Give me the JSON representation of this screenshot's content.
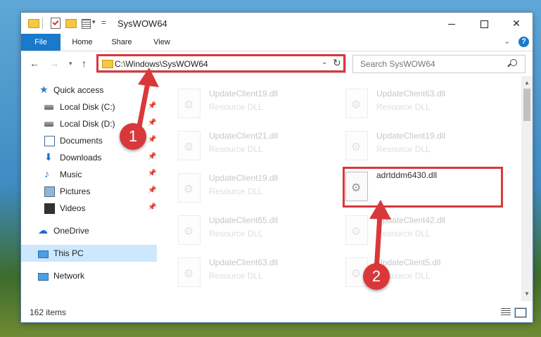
{
  "window": {
    "title": "SysWOW64",
    "minimize": "—",
    "maximize": "☐",
    "close": "✕"
  },
  "ribbon": {
    "tabs": [
      {
        "label": "File"
      },
      {
        "label": "Home"
      },
      {
        "label": "Share"
      },
      {
        "label": "View"
      }
    ],
    "help": "?"
  },
  "address": {
    "path": "C:\\Windows\\SysWOW64",
    "search_placeholder": "Search SysWOW64"
  },
  "sidebar": {
    "items": [
      {
        "label": "Quick access",
        "icon": "star-icon"
      },
      {
        "label": "Local Disk (C:)",
        "icon": "disk-icon"
      },
      {
        "label": "Local Disk (D:)",
        "icon": "disk-icon"
      },
      {
        "label": "Documents",
        "icon": "documents-icon"
      },
      {
        "label": "Downloads",
        "icon": "downloads-icon"
      },
      {
        "label": "Music",
        "icon": "music-icon"
      },
      {
        "label": "Pictures",
        "icon": "pictures-icon"
      },
      {
        "label": "Videos",
        "icon": "videos-icon"
      },
      {
        "label": "OneDrive",
        "icon": "onedrive-icon"
      },
      {
        "label": "This PC",
        "icon": "pc-icon"
      },
      {
        "label": "Network",
        "icon": "network-icon"
      }
    ]
  },
  "files": [
    {
      "name": "UpdateClient19.dll",
      "type": "Resource DLL"
    },
    {
      "name": "UpdateClient63.dll",
      "type": "Resource DLL"
    },
    {
      "name": "UpdateClient21.dll",
      "type": "Resource DLL"
    },
    {
      "name": "UpdateClient19.dll",
      "type": "Resource DLL"
    },
    {
      "name": "UpdateClient19.dll",
      "type": "Resource DLL"
    },
    {
      "name": "adrtddm6430.dll",
      "type": ""
    },
    {
      "name": "UpdateClient65.dll",
      "type": "Resource DLL"
    },
    {
      "name": "UpdateClient42.dll",
      "type": "Resource DLL"
    },
    {
      "name": "UpdateClient63.dll",
      "type": "Resource DLL"
    },
    {
      "name": "UpdateClient5.dll",
      "type": "Resource DLL"
    }
  ],
  "status": {
    "item_count": "162 items"
  },
  "annotations": {
    "step1": "1",
    "step2": "2",
    "color": "#d9383b"
  }
}
